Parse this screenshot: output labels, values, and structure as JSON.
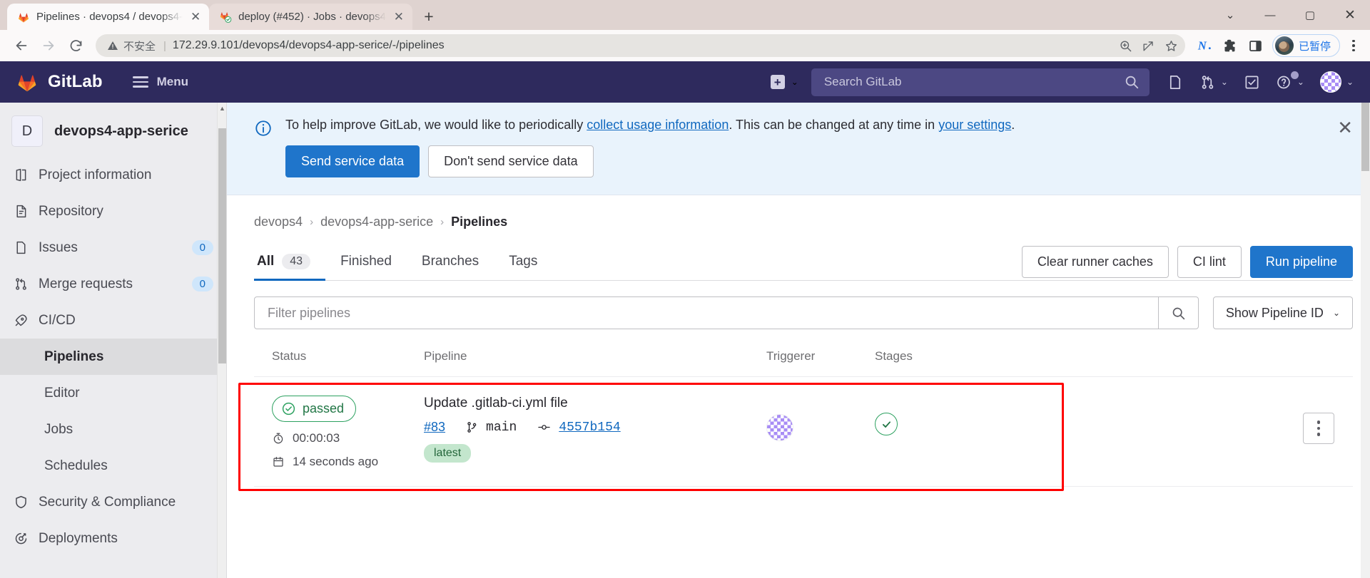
{
  "browser": {
    "tabs": [
      {
        "title": "Pipelines · devops4 / devops4-",
        "favicon": "gitlab-icon",
        "active": true,
        "close_label": "✕"
      },
      {
        "title": "deploy (#452) · Jobs · devops4",
        "favicon": "gitlab-passed-icon",
        "active": false,
        "close_label": "✕"
      }
    ],
    "new_tab_label": "+",
    "window_controls": {
      "minimize": "—",
      "maximize": "▢",
      "close": "✕",
      "collapse": "⌄"
    },
    "nav": {
      "back": "←",
      "forward": "→",
      "reload": "⟳"
    },
    "omnibox": {
      "security_label": "不安全",
      "separator": "|",
      "url": "172.29.9.101/devops4/devops4-app-serice/-/pipelines",
      "zoom_icon": "zoom-in-icon",
      "share_icon": "share-icon",
      "bookmark_icon": "star-icon"
    },
    "extensions": [
      {
        "name": "n-extension-icon",
        "glyph": "N"
      },
      {
        "name": "extensions-puzzle-icon",
        "glyph": "🧩"
      },
      {
        "name": "side-panel-icon",
        "glyph": "▯"
      }
    ],
    "profile": {
      "label": "已暂停",
      "avatar": "user-avatar"
    },
    "menu_label": "⋮"
  },
  "gitlab_nav": {
    "brand": "GitLab",
    "menu_label": "Menu",
    "create_label": "+",
    "search_placeholder": "Search GitLab",
    "icons": [
      {
        "name": "issues-icon"
      },
      {
        "name": "merge-requests-icon"
      },
      {
        "name": "todos-icon"
      },
      {
        "name": "help-icon"
      },
      {
        "name": "user-avatar-icon"
      }
    ]
  },
  "sidebar": {
    "project": {
      "initial": "D",
      "name": "devops4-app-serice"
    },
    "items": [
      {
        "label": "Project information",
        "icon": "project-info-icon",
        "badge": ""
      },
      {
        "label": "Repository",
        "icon": "repository-icon",
        "badge": ""
      },
      {
        "label": "Issues",
        "icon": "issues-icon",
        "badge": "0"
      },
      {
        "label": "Merge requests",
        "icon": "merge-requests-icon",
        "badge": "0"
      },
      {
        "label": "CI/CD",
        "icon": "rocket-icon",
        "badge": ""
      }
    ],
    "subitems": [
      {
        "label": "Pipelines",
        "active": true
      },
      {
        "label": "Editor",
        "active": false
      },
      {
        "label": "Jobs",
        "active": false
      },
      {
        "label": "Schedules",
        "active": false
      }
    ],
    "items_after": [
      {
        "label": "Security & Compliance",
        "icon": "shield-icon"
      },
      {
        "label": "Deployments",
        "icon": "deployments-icon"
      }
    ]
  },
  "banner": {
    "icon": "info-icon",
    "text_before": "To help improve GitLab, we would like to periodically ",
    "link1": "collect usage information",
    "text_middle": ". This can be changed at any time in ",
    "link2": "your settings",
    "text_after": ".",
    "primary_button": "Send service data",
    "secondary_button": "Don't send service data",
    "close_label": "✕"
  },
  "breadcrumb": {
    "items": [
      "devops4",
      "devops4-app-serice",
      "Pipelines"
    ],
    "separator": "›"
  },
  "tabs": {
    "items": [
      {
        "label": "All",
        "count": "43",
        "active": true
      },
      {
        "label": "Finished",
        "count": "",
        "active": false
      },
      {
        "label": "Branches",
        "count": "",
        "active": false
      },
      {
        "label": "Tags",
        "count": "",
        "active": false
      }
    ],
    "actions": [
      {
        "label": "Clear runner caches",
        "style": "default"
      },
      {
        "label": "CI lint",
        "style": "default"
      },
      {
        "label": "Run pipeline",
        "style": "primary"
      }
    ]
  },
  "filter": {
    "placeholder": "Filter pipelines",
    "value": "",
    "search_icon": "search-icon",
    "dropdown_label": "Show Pipeline ID"
  },
  "table": {
    "headers": {
      "status": "Status",
      "pipeline": "Pipeline",
      "triggerer": "Triggerer",
      "stages": "Stages"
    },
    "rows": [
      {
        "status": "passed",
        "duration": "00:00:03",
        "duration_icon": "timer-icon",
        "age": "14 seconds ago",
        "age_icon": "calendar-icon",
        "title": "Update .gitlab-ci.yml file",
        "pipeline_id": "#83",
        "branch": "main",
        "branch_icon": "branch-icon",
        "commit_sha": "4557b154",
        "commit_icon": "commit-icon",
        "tag": "latest",
        "triggerer": "triggerer-avatar",
        "stage_status": "passed",
        "actions_label": "⋮"
      }
    ]
  },
  "colors": {
    "gitlab_navy": "#2e2a5d",
    "primary_blue": "#1f75cb",
    "link_blue": "#1068bf",
    "success_green": "#2da160",
    "highlight_red": "#ff0000"
  }
}
